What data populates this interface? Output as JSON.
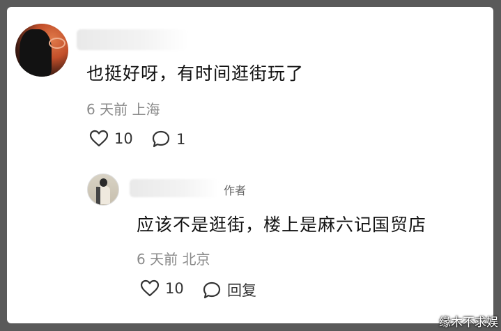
{
  "comment": {
    "text": "也挺好呀，有时间逛街玩了",
    "time": "6 天前",
    "location": "上海",
    "likes": "10",
    "replies": "1"
  },
  "reply": {
    "author_tag": "作者",
    "text": "应该不是逛街，楼上是麻六记国贸店",
    "time": "6 天前",
    "location": "北京",
    "likes": "10",
    "reply_label": "回复"
  },
  "watermark": "缘木不求娱",
  "icons": {
    "like": "heart-icon",
    "comment": "comment-bubble-icon"
  }
}
